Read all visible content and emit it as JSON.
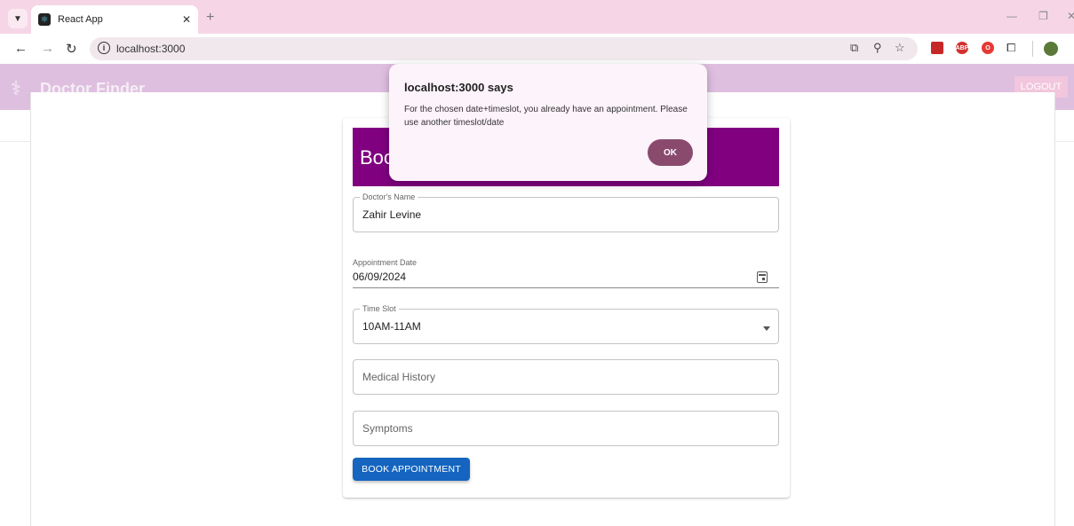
{
  "browser": {
    "tab_title": "React App",
    "tab_close": "✕",
    "new_tab": "+",
    "url": "localhost:3000",
    "window_controls": {
      "minimize": "—",
      "restore": "❐",
      "close": "✕"
    }
  },
  "app": {
    "brand": "Doctor Finder",
    "logout_label": "LOGOUT"
  },
  "form": {
    "title_partial": "Boo",
    "doctor_name": {
      "label": "Doctor's Name",
      "value": "Zahir Levine"
    },
    "appointment_date": {
      "label": "Appointment Date",
      "value": "06/09/2024"
    },
    "time_slot": {
      "label": "Time Slot",
      "value": "10AM-11AM"
    },
    "medical_history": {
      "placeholder": "Medical History"
    },
    "symptoms": {
      "placeholder": "Symptoms"
    },
    "submit_label": "BOOK APPOINTMENT"
  },
  "dialog": {
    "title": "localhost:3000 says",
    "message": "For the chosen date+timeslot, you already have an appointment. Please use another timeslot/date",
    "ok_label": "OK"
  },
  "colors": {
    "tabbar": "#f6d6e6",
    "app_header": "#dfbfe0",
    "card_header": "#800080",
    "primary_button": "#1565c0",
    "dialog_button": "#8a4a6e"
  }
}
